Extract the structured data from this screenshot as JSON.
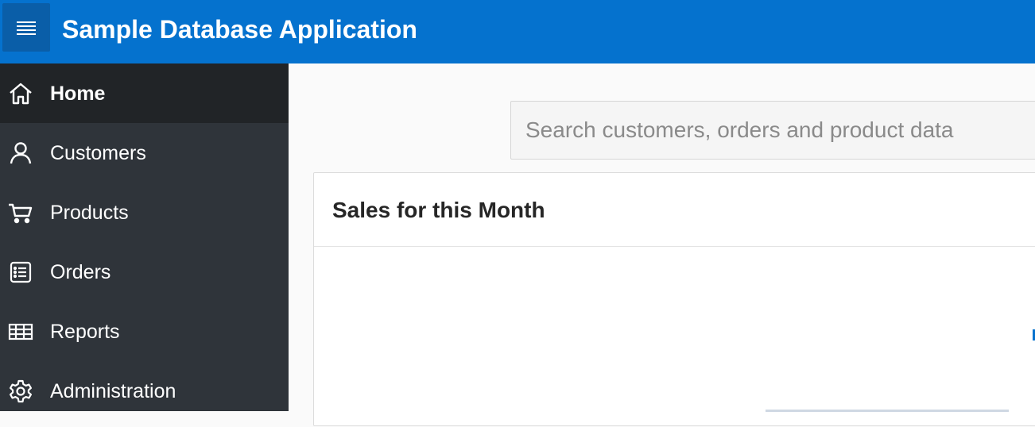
{
  "header": {
    "title": "Sample Database Application",
    "menu_icon": "hamburger-menu-icon"
  },
  "sidebar": {
    "items": [
      {
        "label": "Home",
        "icon": "home-icon",
        "active": true
      },
      {
        "label": "Customers",
        "icon": "user-icon",
        "active": false
      },
      {
        "label": "Products",
        "icon": "cart-icon",
        "active": false
      },
      {
        "label": "Orders",
        "icon": "list-icon",
        "active": false
      },
      {
        "label": "Reports",
        "icon": "table-icon",
        "active": false
      },
      {
        "label": "Administration",
        "icon": "gear-icon",
        "active": false
      }
    ]
  },
  "main": {
    "search": {
      "value": "",
      "placeholder": "Search customers, orders and product data"
    },
    "region": {
      "title": "Sales for this Month"
    }
  },
  "colors": {
    "header_bg": "#0572ce",
    "sidebar_bg": "#2f343a",
    "sidebar_active_bg": "#212427"
  }
}
